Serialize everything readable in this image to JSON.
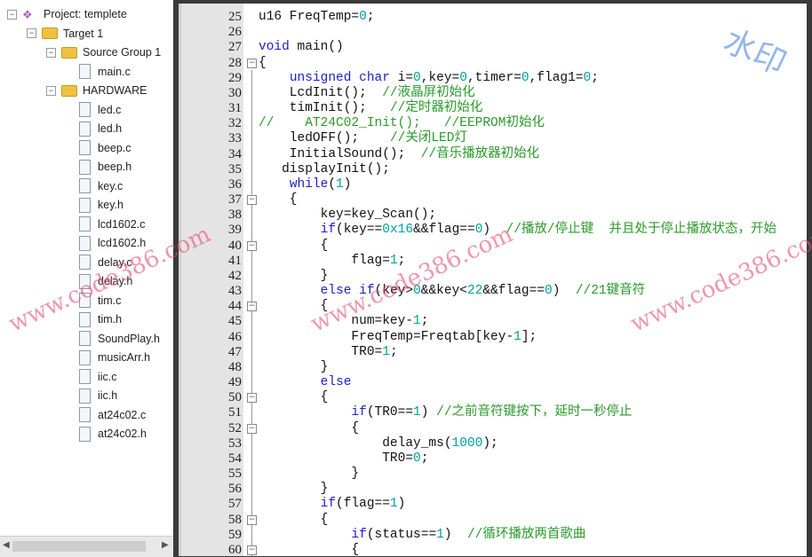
{
  "tree": [
    {
      "label": "Project: templete",
      "level": 0,
      "type": "project",
      "toggle": "⊟"
    },
    {
      "label": "Target 1",
      "level": 1,
      "type": "target",
      "toggle": "⊟"
    },
    {
      "label": "Source Group 1",
      "level": 2,
      "type": "folder",
      "toggle": "⊟"
    },
    {
      "label": "main.c",
      "level": 3,
      "type": "file"
    },
    {
      "label": "HARDWARE",
      "level": 2,
      "type": "folder",
      "toggle": "⊟"
    },
    {
      "label": "led.c",
      "level": 3,
      "type": "file"
    },
    {
      "label": "led.h",
      "level": 3,
      "type": "file"
    },
    {
      "label": "beep.c",
      "level": 3,
      "type": "file"
    },
    {
      "label": "beep.h",
      "level": 3,
      "type": "file"
    },
    {
      "label": "key.c",
      "level": 3,
      "type": "file"
    },
    {
      "label": "key.h",
      "level": 3,
      "type": "file"
    },
    {
      "label": "lcd1602.c",
      "level": 3,
      "type": "file"
    },
    {
      "label": "lcd1602.h",
      "level": 3,
      "type": "file"
    },
    {
      "label": "delay.c",
      "level": 3,
      "type": "file"
    },
    {
      "label": "delay.h",
      "level": 3,
      "type": "file"
    },
    {
      "label": "tim.c",
      "level": 3,
      "type": "file"
    },
    {
      "label": "tim.h",
      "level": 3,
      "type": "file"
    },
    {
      "label": "SoundPlay.h",
      "level": 3,
      "type": "file"
    },
    {
      "label": "musicArr.h",
      "level": 3,
      "type": "file"
    },
    {
      "label": "iic.c",
      "level": 3,
      "type": "file"
    },
    {
      "label": "iic.h",
      "level": 3,
      "type": "file"
    },
    {
      "label": "at24c02.c",
      "level": 3,
      "type": "file"
    },
    {
      "label": "at24c02.h",
      "level": 3,
      "type": "file"
    }
  ],
  "colors": {
    "keyword": "#2020d0",
    "number": "#00a0a0",
    "comment": "#2a9a2a"
  },
  "watermarks": {
    "text": "www.code386.com",
    "cn": "水印"
  },
  "code": [
    {
      "n": "25",
      "s": [
        [
          "",
          "u16 FreqTemp="
        ],
        [
          "num",
          "0"
        ],
        [
          "",
          ";"
        ]
      ]
    },
    {
      "n": "26",
      "s": []
    },
    {
      "n": "27",
      "s": [
        [
          "kw",
          "void"
        ],
        [
          "",
          " main()"
        ]
      ]
    },
    {
      "n": "28",
      "f": true,
      "s": [
        [
          "",
          "{"
        ]
      ]
    },
    {
      "n": "29",
      "s": [
        [
          "",
          "    "
        ],
        [
          "kw",
          "unsigned char"
        ],
        [
          "",
          " i="
        ],
        [
          "num",
          "0"
        ],
        [
          "",
          ",key="
        ],
        [
          "num",
          "0"
        ],
        [
          "",
          ",timer="
        ],
        [
          "num",
          "0"
        ],
        [
          "",
          ",flag1="
        ],
        [
          "num",
          "0"
        ],
        [
          "",
          ";"
        ]
      ]
    },
    {
      "n": "30",
      "s": [
        [
          "",
          "    LcdInit();  "
        ],
        [
          "cm",
          "//液晶屏初始化"
        ]
      ]
    },
    {
      "n": "31",
      "s": [
        [
          "",
          "    timInit();   "
        ],
        [
          "cm",
          "//定时器初始化"
        ]
      ]
    },
    {
      "n": "32",
      "s": [
        [
          "cm",
          "//    AT24C02_Init();   //EEPROM初始化"
        ]
      ]
    },
    {
      "n": "33",
      "s": [
        [
          "",
          "    ledOFF();    "
        ],
        [
          "cm",
          "//关闭LED灯"
        ]
      ]
    },
    {
      "n": "34",
      "s": [
        [
          "",
          "    InitialSound();  "
        ],
        [
          "cm",
          "//音乐播放器初始化"
        ]
      ]
    },
    {
      "n": "35",
      "s": [
        [
          "",
          "   displayInit();"
        ]
      ]
    },
    {
      "n": "36",
      "s": [
        [
          "",
          "    "
        ],
        [
          "kw",
          "while"
        ],
        [
          "",
          "("
        ],
        [
          "num",
          "1"
        ],
        [
          "",
          ")"
        ]
      ]
    },
    {
      "n": "37",
      "f": true,
      "s": [
        [
          "",
          "    {"
        ]
      ]
    },
    {
      "n": "38",
      "s": [
        [
          "",
          "        key=key_Scan();"
        ]
      ]
    },
    {
      "n": "39",
      "s": [
        [
          "",
          "        "
        ],
        [
          "kw",
          "if"
        ],
        [
          "",
          "(key=="
        ],
        [
          "num",
          "0x16"
        ],
        [
          "",
          "&&flag=="
        ],
        [
          "num",
          "0"
        ],
        [
          "",
          ")  "
        ],
        [
          "cm",
          "//播放/停止键  并且处于停止播放状态，开始"
        ]
      ]
    },
    {
      "n": "40",
      "f": true,
      "s": [
        [
          "",
          "        {"
        ]
      ]
    },
    {
      "n": "41",
      "s": [
        [
          "",
          "            flag="
        ],
        [
          "num",
          "1"
        ],
        [
          "",
          ";"
        ]
      ]
    },
    {
      "n": "42",
      "s": [
        [
          "",
          "        }"
        ]
      ]
    },
    {
      "n": "43",
      "s": [
        [
          "",
          "        "
        ],
        [
          "kw",
          "else if"
        ],
        [
          "",
          "(key>"
        ],
        [
          "num",
          "0"
        ],
        [
          "",
          "&&key<"
        ],
        [
          "num",
          "22"
        ],
        [
          "",
          "&&flag=="
        ],
        [
          "num",
          "0"
        ],
        [
          "",
          ")  "
        ],
        [
          "cm",
          "//21键音符"
        ]
      ]
    },
    {
      "n": "44",
      "f": true,
      "s": [
        [
          "",
          "        {"
        ]
      ]
    },
    {
      "n": "45",
      "s": [
        [
          "",
          "            num=key-"
        ],
        [
          "num",
          "1"
        ],
        [
          "",
          ";"
        ]
      ]
    },
    {
      "n": "46",
      "s": [
        [
          "",
          "            FreqTemp=Freqtab[key-"
        ],
        [
          "num",
          "1"
        ],
        [
          "",
          "];"
        ]
      ]
    },
    {
      "n": "47",
      "s": [
        [
          "",
          "            TR0="
        ],
        [
          "num",
          "1"
        ],
        [
          "",
          ";"
        ]
      ]
    },
    {
      "n": "48",
      "s": [
        [
          "",
          "        }"
        ]
      ]
    },
    {
      "n": "49",
      "s": [
        [
          "",
          "        "
        ],
        [
          "kw",
          "else"
        ]
      ]
    },
    {
      "n": "50",
      "f": true,
      "s": [
        [
          "",
          "        {"
        ]
      ]
    },
    {
      "n": "51",
      "s": [
        [
          "",
          "            "
        ],
        [
          "kw",
          "if"
        ],
        [
          "",
          "(TR0=="
        ],
        [
          "num",
          "1"
        ],
        [
          "",
          ") "
        ],
        [
          "cm",
          "//之前音符键按下，延时一秒停止"
        ]
      ]
    },
    {
      "n": "52",
      "f": true,
      "s": [
        [
          "",
          "            {"
        ]
      ]
    },
    {
      "n": "53",
      "s": [
        [
          "",
          "                delay_ms("
        ],
        [
          "num",
          "1000"
        ],
        [
          "",
          ");"
        ]
      ]
    },
    {
      "n": "54",
      "s": [
        [
          "",
          "                TR0="
        ],
        [
          "num",
          "0"
        ],
        [
          "",
          ";"
        ]
      ]
    },
    {
      "n": "55",
      "s": [
        [
          "",
          "            }"
        ]
      ]
    },
    {
      "n": "56",
      "s": [
        [
          "",
          "        }"
        ]
      ]
    },
    {
      "n": "57",
      "s": [
        [
          "",
          "        "
        ],
        [
          "kw",
          "if"
        ],
        [
          "",
          "(flag=="
        ],
        [
          "num",
          "1"
        ],
        [
          "",
          ")"
        ]
      ]
    },
    {
      "n": "58",
      "f": true,
      "s": [
        [
          "",
          "        {"
        ]
      ]
    },
    {
      "n": "59",
      "s": [
        [
          "",
          "            "
        ],
        [
          "kw",
          "if"
        ],
        [
          "",
          "(status=="
        ],
        [
          "num",
          "1"
        ],
        [
          "",
          ")  "
        ],
        [
          "cm",
          "//循环播放两首歌曲"
        ]
      ]
    },
    {
      "n": "60",
      "f": true,
      "s": [
        [
          "",
          "            {"
        ]
      ]
    }
  ]
}
